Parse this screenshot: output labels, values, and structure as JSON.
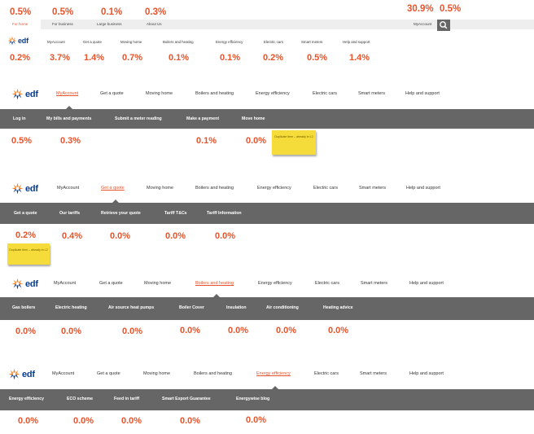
{
  "top_bar": {
    "links": [
      "For home",
      "For business",
      "Large business",
      "About Us"
    ],
    "account_label": "MyAccount",
    "pct_links": [
      "0.5%",
      "0.5%",
      "0.1%",
      "0.3%"
    ],
    "pct_right": [
      "30.9%",
      "0.5%"
    ]
  },
  "brand": {
    "name": "edf"
  },
  "main_nav": [
    "MyAccount",
    "Get a quote",
    "Moving home",
    "Boilers and heating",
    "Energy efficiency",
    "Electric cars",
    "Smart meters",
    "Help and support"
  ],
  "nav_pct": [
    "0.2%",
    "3.7%",
    "1.4%",
    "0.7%",
    "0.1%",
    "0.1%",
    "0.2%",
    "0.5%",
    "1.4%"
  ],
  "sections": [
    {
      "active": "MyAccount",
      "sub_items": [
        "Log in",
        "My bills and payments",
        "Submit a meter reading",
        "Make a payment",
        "Move home"
      ],
      "pct": [
        "0.5%",
        "0.3%",
        "0.1%",
        "0.0%"
      ],
      "note": "Duplicate item – already in L2"
    },
    {
      "active": "Get a quote",
      "sub_items": [
        "Get a quote",
        "Our tariffs",
        "Retrieve your quote",
        "Tariff T&Cs",
        "Tariff Information"
      ],
      "pct": [
        "0.2%",
        "0.4%",
        "0.0%",
        "0.0%",
        "0.0%"
      ],
      "note": "Duplicate item – already in L2"
    },
    {
      "active": "Boilers and heating",
      "sub_items": [
        "Gas boilers",
        "Electric heating",
        "Air source heat pumps",
        "Boiler Cover",
        "Insulation",
        "Air conditioning",
        "Heating advice"
      ],
      "pct": [
        "0.0%",
        "0.0%",
        "0.0%",
        "0.0%",
        "0.0%",
        "0.0%",
        "0.0%"
      ]
    },
    {
      "active": "Energy efficiency",
      "sub_items": [
        "Energy efficiency",
        "ECO scheme",
        "Feed in tariff",
        "Smart Export Guarantee",
        "Energywise blog"
      ],
      "pct": [
        "0.0%",
        "0.0%",
        "0.0%",
        "0.0%",
        "0.0%"
      ]
    }
  ],
  "colors": {
    "accent": "#e8532a",
    "bar": "#666666",
    "brand_blue": "#0a3c8c",
    "sticky": "#f6dc3a"
  },
  "icons": [
    "edf-logo-icon",
    "search-icon"
  ]
}
